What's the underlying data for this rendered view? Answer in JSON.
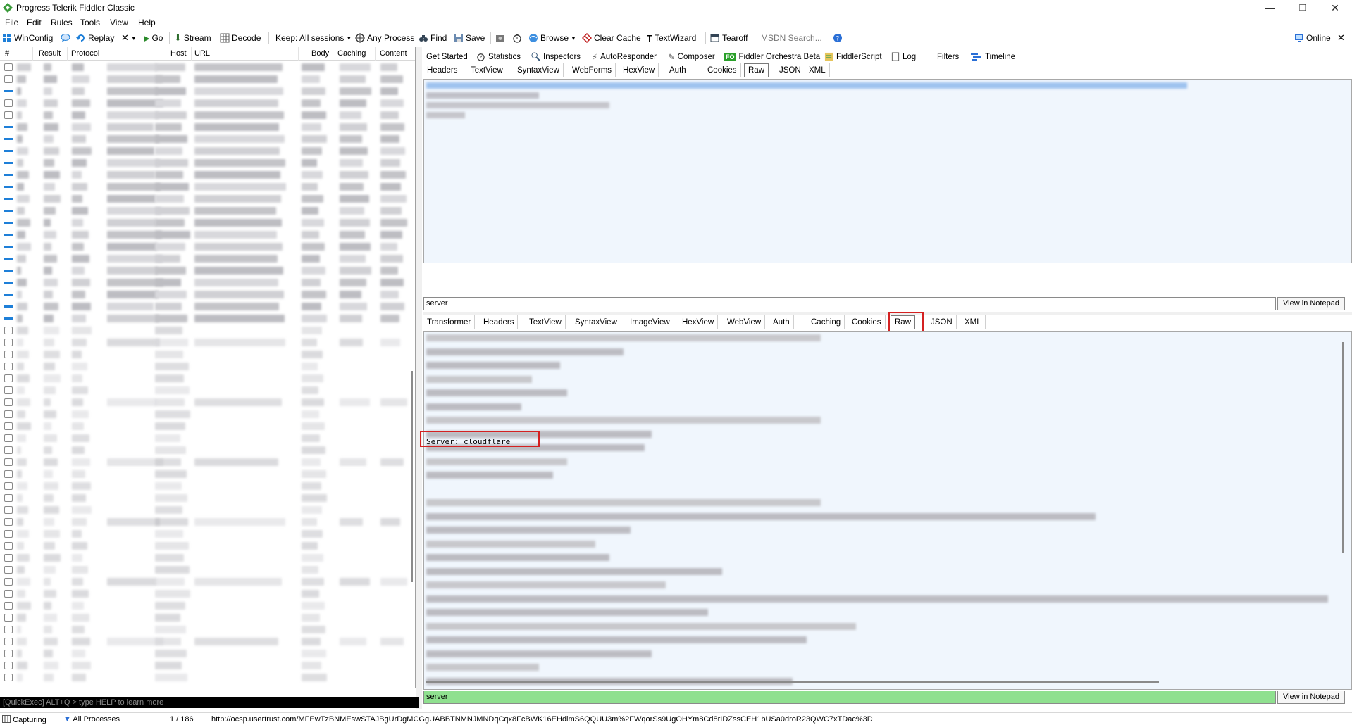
{
  "window": {
    "title": "Progress Telerik Fiddler Classic",
    "controls": {
      "minimize": "—",
      "restore": "❐",
      "close": "✕"
    }
  },
  "menu": [
    "File",
    "Edit",
    "Rules",
    "Tools",
    "View",
    "Help"
  ],
  "toolbar": {
    "winconfig": "WinConfig",
    "replay": "Replay",
    "remove": "✕",
    "go": "Go",
    "stream": "Stream",
    "decode": "Decode",
    "keep": "Keep: All sessions",
    "any_process": "Any Process",
    "find": "Find",
    "save": "Save",
    "browse": "Browse",
    "clear_cache": "Clear Cache",
    "textwizard": "TextWizard",
    "tearoff": "Tearoff",
    "msdn_search": "MSDN Search...",
    "online": "Online"
  },
  "sessions": {
    "columns": [
      "#",
      "Result",
      "Protocol",
      "Host",
      "URL",
      "Body",
      "Caching",
      "Content"
    ],
    "row_count": 52
  },
  "quickexec": {
    "placeholder": "[QuickExec] ALT+Q > type HELP to learn more"
  },
  "main_tabs": [
    "Get Started",
    "Statistics",
    "Inspectors",
    "AutoResponder",
    "Composer",
    "Fiddler Orchestra Beta",
    "FiddlerScript",
    "Log",
    "Filters",
    "Timeline"
  ],
  "orchestra_badge": "FO",
  "request_tabs": [
    "Headers",
    "TextView",
    "SyntaxView",
    "WebForms",
    "HexView",
    "Auth",
    "Cookies",
    "Raw",
    "JSON",
    "XML"
  ],
  "request_selected": "Raw",
  "request_find": {
    "value": "server",
    "button": "View in Notepad"
  },
  "response_tabs": [
    "Transformer",
    "Headers",
    "TextView",
    "SyntaxView",
    "ImageView",
    "HexView",
    "WebView",
    "Auth",
    "Caching",
    "Cookies",
    "Raw",
    "JSON",
    "XML"
  ],
  "response_selected": "Raw",
  "response_highlight_line": "Server: cloudflare",
  "response_find": {
    "value": "server",
    "button": "View in Notepad"
  },
  "status": {
    "capturing": "Capturing",
    "processes": "All Processes",
    "count": "1 / 186",
    "url": "http://ocsp.usertrust.com/MFEwTzBNMEswSTAJBgUrDgMCGgUABBTNMNJMNDqCqx8FcBWK16EHdimS6QQUU3m%2FWqorSs9UgOHYm8Cd8rIDZssCEH1bUSa0droR23QWC7xTDac%3D"
  },
  "colors": {
    "accent_blue": "#1e7fd8",
    "find_green": "#8fe08f",
    "highlight_red": "#d42121",
    "pane_bg": "#f0f6fd"
  }
}
